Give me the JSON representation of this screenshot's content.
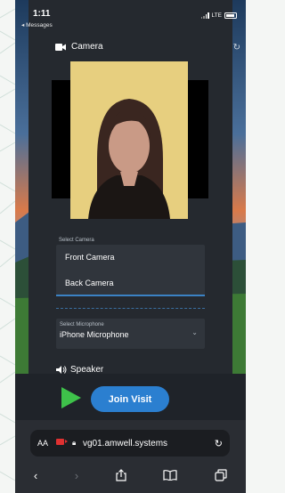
{
  "status_bar": {
    "time": "1:11",
    "back_label": "◂ Messages",
    "carrier": "LTE"
  },
  "camera": {
    "header": "Camera",
    "select_label": "Select Camera",
    "options": [
      "Front Camera",
      "Back Camera"
    ],
    "selected": "Back Camera"
  },
  "microphone": {
    "select_label": "Select Microphone",
    "value": "iPhone Microphone"
  },
  "speaker": {
    "header": "Speaker"
  },
  "actions": {
    "join_label": "Join Visit"
  },
  "browser": {
    "text_size_label": "AA",
    "url": "vg01.amwell.systems"
  },
  "colors": {
    "join_button": "#2b7fd0",
    "play_icon": "#3ec24a",
    "recording_icon": "#e03131",
    "panel": "#25292f"
  }
}
